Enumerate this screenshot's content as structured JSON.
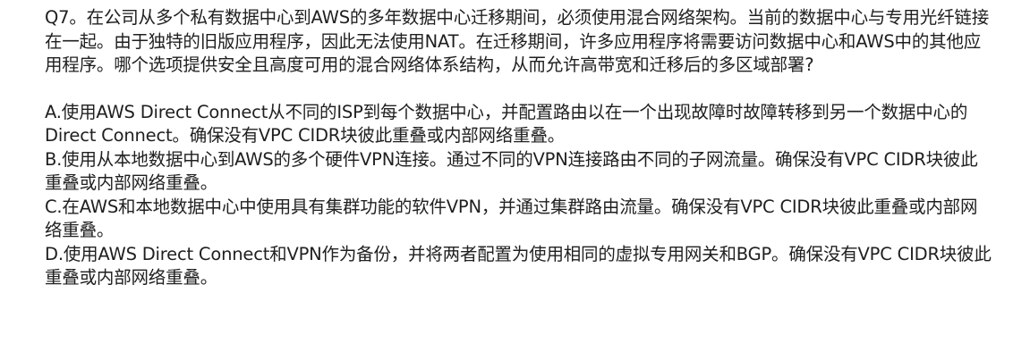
{
  "question": {
    "text": "Q7。在公司从多个私有数据中心到AWS的多年数据中心迁移期间，必须使用混合网络架构。当前的数据中心与专用光纤链接在一起。由于独特的旧版应用程序，因此无法使用NAT。在迁移期间，许多应用程序将需要访问数据中心和AWS中的其他应用程序。哪个选项提供安全且高度可用的混合网络体系结构，从而允许高带宽和迁移后的多区域部署?"
  },
  "options": [
    {
      "text": "A.使用AWS Direct Connect从不同的ISP到每个数据中心，并配置路由以在一个出现故障时故障转移到另一个数据中心的Direct Connect。确保没有VPC CIDR块彼此重叠或内部网络重叠。"
    },
    {
      "text": "B.使用从本地数据中心到AWS的多个硬件VPN连接。通过不同的VPN连接路由不同的子网流量。确保没有VPC CIDR块彼此重叠或内部网络重叠。"
    },
    {
      "text": "C.在AWS和本地数据中心中使用具有集群功能的软件VPN，并通过集群路由流量。确保没有VPC CIDR块彼此重叠或内部网络重叠。"
    },
    {
      "text": "D.使用AWS Direct Connect和VPN作为备份，并将两者配置为使用相同的虚拟专用网关和BGP。确保没有VPC CIDR块彼此重叠或内部网络重叠。"
    }
  ]
}
